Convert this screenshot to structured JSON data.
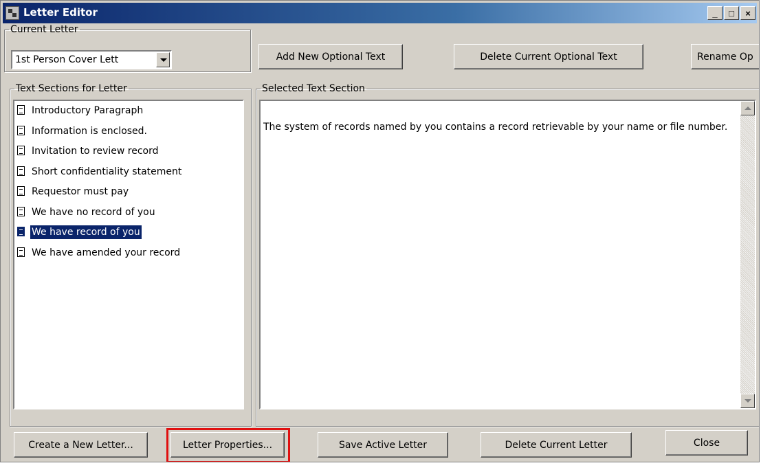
{
  "window": {
    "title": "Letter Editor",
    "controls": {
      "minimize": "_",
      "maximize": "□",
      "close": "×"
    }
  },
  "current_letter": {
    "group_label": "Current Letter",
    "selected_value": "1st Person Cover Lett"
  },
  "toolbar": {
    "add_optional_text": "Add New Optional Text",
    "delete_optional_text": "Delete Current Optional Text",
    "rename_optional_text": "Rename Op"
  },
  "sections_panel": {
    "group_label": "Text Sections for Letter",
    "items": [
      {
        "label": "Introductory Paragraph",
        "selected": false
      },
      {
        "label": "Information is enclosed.",
        "selected": false
      },
      {
        "label": "Invitation to review record",
        "selected": false
      },
      {
        "label": "Short confidentiality statement",
        "selected": false
      },
      {
        "label": "Requestor must pay",
        "selected": false
      },
      {
        "label": "We have no record of you",
        "selected": false
      },
      {
        "label": "We have record of you",
        "selected": true
      },
      {
        "label": "We have amended your record",
        "selected": false
      }
    ]
  },
  "selected_section": {
    "group_label": "Selected Text Section",
    "text": "The system of records named by you contains a record retrievable by your name or file number."
  },
  "footer": {
    "create_letter": "Create a New Letter...",
    "letter_properties": "Letter Properties...",
    "save_letter": "Save Active Letter",
    "delete_letter": "Delete Current Letter",
    "close": "Close"
  },
  "colors": {
    "highlight_border": "#e01010",
    "selection": "#0a246a",
    "dialog_face": "#d4d0c8"
  }
}
